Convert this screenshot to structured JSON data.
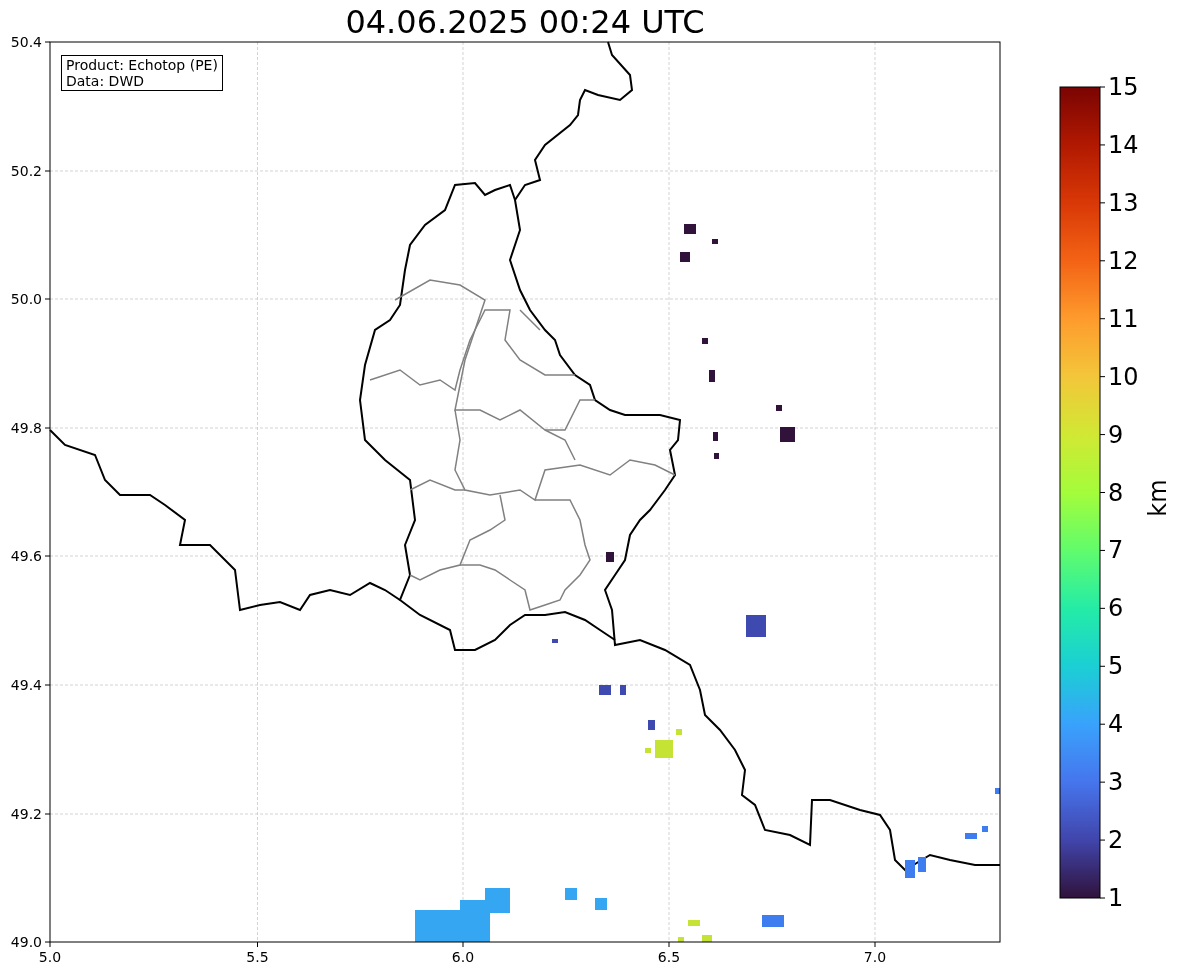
{
  "title": "04.06.2025 00:24 UTC",
  "legend": [
    "Product: Echotop (PE)",
    "Data: DWD"
  ],
  "x_ticks": [
    "5.0",
    "5.5",
    "6.0",
    "6.5",
    "7.0"
  ],
  "y_ticks": [
    "50.4",
    "50.2",
    "50.0",
    "49.8",
    "49.6",
    "49.4",
    "49.2",
    "49.0"
  ],
  "colorbar": {
    "label": "km",
    "ticks": [
      "15",
      "14",
      "13",
      "12",
      "11",
      "10",
      "9",
      "8",
      "7",
      "6",
      "5",
      "4",
      "3",
      "2",
      "1"
    ]
  }
}
